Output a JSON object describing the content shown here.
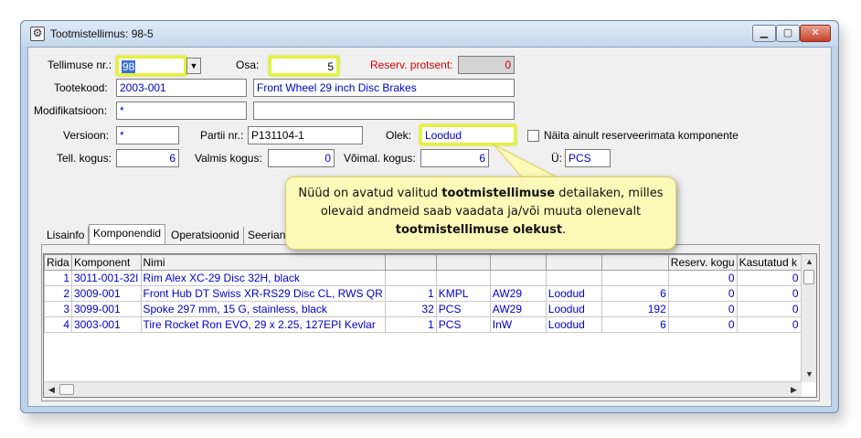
{
  "window": {
    "title": "Tootmistellimus: 98-5"
  },
  "form": {
    "order_no_label": "Tellimuse nr.:",
    "order_no_value": "98",
    "part_label": "Osa:",
    "part_value": "5",
    "reserve_pct_label": "Reserv. protsent:",
    "reserve_pct_value": "0",
    "product_code_label": "Tootekood:",
    "product_code_value": "2003-001",
    "product_name_value": "Front Wheel 29 inch Disc Brakes",
    "modification_label": "Modifikatsioon:",
    "modification_value": "*",
    "version_label": "Versioon:",
    "version_value": "*",
    "batch_label": "Partii nr.:",
    "batch_value": "P131104-1",
    "status_label": "Olek:",
    "status_value": "Loodud",
    "show_unreserved_label": "Näita ainult reserveerimata komponente",
    "order_qty_label": "Tell. kogus:",
    "order_qty_value": "6",
    "ready_qty_label": "Valmis kogus:",
    "ready_qty_value": "0",
    "possible_qty_label": "Võimal. kogus:",
    "possible_qty_value": "6",
    "unit_label_fragment": "Ü:",
    "unit_value": "PCS"
  },
  "tabs": [
    {
      "label": "Lisainfo"
    },
    {
      "label": "Komponendid"
    },
    {
      "label": "Operatsioonid"
    },
    {
      "label": "Seerian"
    }
  ],
  "grid": {
    "headers": {
      "row": "Rida",
      "component": "Komponent",
      "name": "Nimi",
      "reserved_qty": "Reserv. kogu",
      "used_qty": "Kasutatud k"
    },
    "rows": [
      {
        "row": "1",
        "component": "3011-001-32I",
        "name": "Rim Alex XC-29 Disc 32H, black",
        "qty": "",
        "unit": "",
        "warehouse": "",
        "status": "",
        "need": "",
        "reserved": "0",
        "used": "0"
      },
      {
        "row": "2",
        "component": "3009-001",
        "name": "Front Hub DT Swiss XR-RS29 Disc CL, RWS QR",
        "qty": "1",
        "unit": "KMPL",
        "warehouse": "AW29",
        "status": "Loodud",
        "need": "6",
        "reserved": "0",
        "used": "0"
      },
      {
        "row": "3",
        "component": "3099-001",
        "name": "Spoke 297 mm, 15 G, stainless, black",
        "qty": "32",
        "unit": "PCS",
        "warehouse": "AW29",
        "status": "Loodud",
        "need": "192",
        "reserved": "0",
        "used": "0"
      },
      {
        "row": "4",
        "component": "3003-001",
        "name": "Tire Rocket Ron EVO, 29 x 2.25, 127EPI Kevlar",
        "qty": "1",
        "unit": "PCS",
        "warehouse": "InW",
        "status": "Loodud",
        "need": "6",
        "reserved": "0",
        "used": "0"
      }
    ]
  },
  "callout": {
    "text_1": "Nüüd on avatud valitud ",
    "bold_1": "tootmistellimuse",
    "text_2": " detailaken, milles olevaid andmeid saab vaadata ja/või muuta olenevalt ",
    "bold_2": "tootmistellimuse olekust",
    "text_3": "."
  },
  "colors": {
    "value_text": "#0000c8",
    "highlight": "#e5f23a",
    "callout_bg": "#fdf9b8",
    "reserve_label": "#d40000"
  }
}
